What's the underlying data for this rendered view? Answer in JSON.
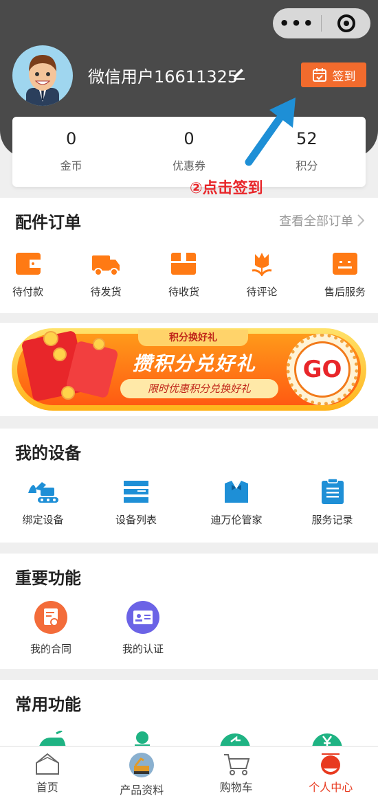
{
  "header": {
    "username": "微信用户16611325",
    "signin_label": "签到",
    "menu_dots": "•••"
  },
  "stats": [
    {
      "value": "0",
      "label": "金币"
    },
    {
      "value": "0",
      "label": "优惠券"
    },
    {
      "value": "52",
      "label": "积分"
    }
  ],
  "annotation": "②点击签到",
  "orders": {
    "title": "配件订单",
    "view_all": "查看全部订单",
    "items": [
      {
        "label": "待付款",
        "icon": "wallet-icon"
      },
      {
        "label": "待发货",
        "icon": "truck-icon"
      },
      {
        "label": "待收货",
        "icon": "package-icon"
      },
      {
        "label": "待评论",
        "icon": "flower-icon"
      },
      {
        "label": "售后服务",
        "icon": "service-icon"
      }
    ]
  },
  "banner": {
    "tag": "积分换好礼",
    "title": "攒积分兑好礼",
    "subtitle": "限时优惠积分兑换好礼",
    "go": "GO"
  },
  "devices": {
    "title": "我的设备",
    "items": [
      {
        "label": "绑定设备",
        "icon": "excavator-icon"
      },
      {
        "label": "设备列表",
        "icon": "list-icon"
      },
      {
        "label": "迪万伦管家",
        "icon": "butler-icon"
      },
      {
        "label": "服务记录",
        "icon": "clipboard-icon"
      }
    ]
  },
  "important": {
    "title": "重要功能",
    "items": [
      {
        "label": "我的合同",
        "icon": "contract-icon"
      },
      {
        "label": "我的认证",
        "icon": "id-card-icon"
      }
    ]
  },
  "common": {
    "title": "常用功能"
  },
  "tabbar": [
    {
      "label": "首页",
      "icon": "home-icon"
    },
    {
      "label": "产品资料",
      "icon": "product-icon"
    },
    {
      "label": "购物车",
      "icon": "cart-icon"
    },
    {
      "label": "个人中心",
      "icon": "profile-icon"
    }
  ],
  "colors": {
    "accent": "#ff7a14",
    "signin": "#f26b2d",
    "active_tab": "#e83a1f",
    "annotation": "#e8262a",
    "arrow": "#1e8fd6"
  }
}
